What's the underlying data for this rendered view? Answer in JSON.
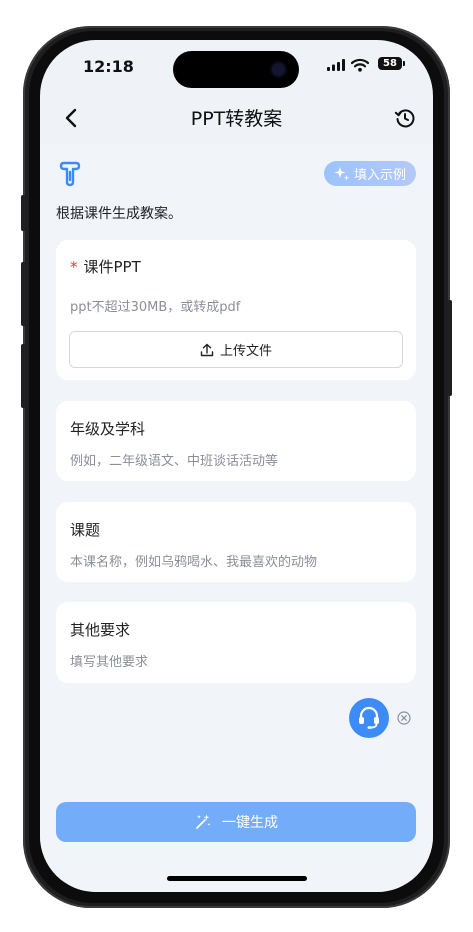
{
  "status": {
    "time": "12:18",
    "battery": "58"
  },
  "header": {
    "title": "PPT转教案"
  },
  "intro": {
    "fill_example_label": "填入示例",
    "description": "根据课件生成教案。"
  },
  "form": {
    "courseware": {
      "required_mark": "*",
      "label": "课件PPT",
      "hint": "ppt不超过30MB，或转成pdf",
      "upload_label": "上传文件"
    },
    "grade_subject": {
      "label": "年级及学科",
      "placeholder": "例如，二年级语文、中班谈话活动等"
    },
    "topic": {
      "label": "课题",
      "placeholder": "本课名称，例如乌鸦喝水、我最喜欢的动物"
    },
    "other": {
      "label": "其他要求",
      "placeholder": "填写其他要求"
    }
  },
  "actions": {
    "generate_label": "一键生成"
  },
  "colors": {
    "accent": "#3d8bf6",
    "generate_bg": "#73adfa",
    "required": "#e53935"
  },
  "icons": [
    "back-arrow-icon",
    "history-icon",
    "app-logo-icon",
    "sparkle-icon",
    "upload-icon",
    "headset-icon",
    "close-circle-icon",
    "magic-wand-icon"
  ]
}
